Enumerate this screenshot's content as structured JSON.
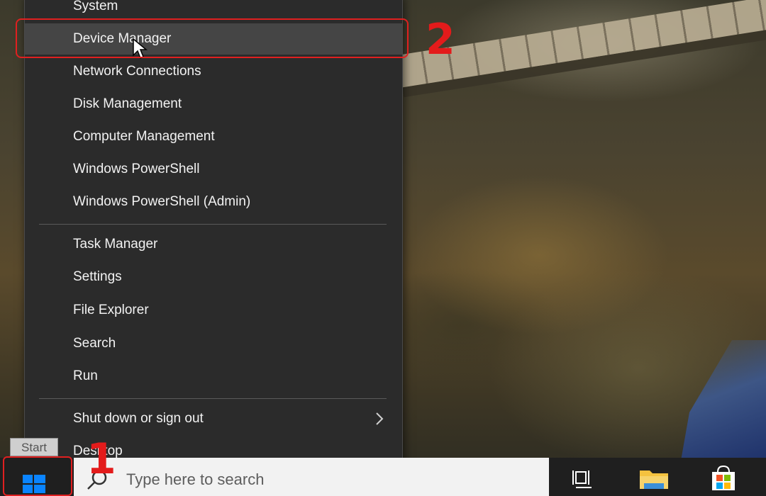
{
  "context_menu": {
    "items": [
      {
        "label": "System"
      },
      {
        "label": "Device Manager"
      },
      {
        "label": "Network Connections"
      },
      {
        "label": "Disk Management"
      },
      {
        "label": "Computer Management"
      },
      {
        "label": "Windows PowerShell"
      },
      {
        "label": "Windows PowerShell (Admin)"
      },
      {
        "label": "Task Manager"
      },
      {
        "label": "Settings"
      },
      {
        "label": "File Explorer"
      },
      {
        "label": "Search"
      },
      {
        "label": "Run"
      },
      {
        "label": "Shut down or sign out"
      },
      {
        "label": "Desktop"
      }
    ],
    "highlighted_item": "Device Manager",
    "submenu_icon": "chevron-right-icon"
  },
  "annotations": {
    "step_1": "1",
    "step_2": "2",
    "color": "#e02020"
  },
  "tooltip": {
    "text": "Start"
  },
  "taskbar": {
    "start_icon": "windows-logo-icon",
    "search_placeholder": "Type here to search",
    "search_icon": "search-icon",
    "pinned": [
      {
        "icon": "task-view-icon"
      },
      {
        "icon": "file-explorer-icon"
      },
      {
        "icon": "microsoft-store-icon"
      }
    ]
  },
  "colors": {
    "menu_background": "#2b2b2b",
    "menu_highlight": "#454545",
    "menu_text": "#f2f2f2",
    "taskbar_background": "#1f1f1f",
    "windows_accent": "#0a84ff"
  }
}
